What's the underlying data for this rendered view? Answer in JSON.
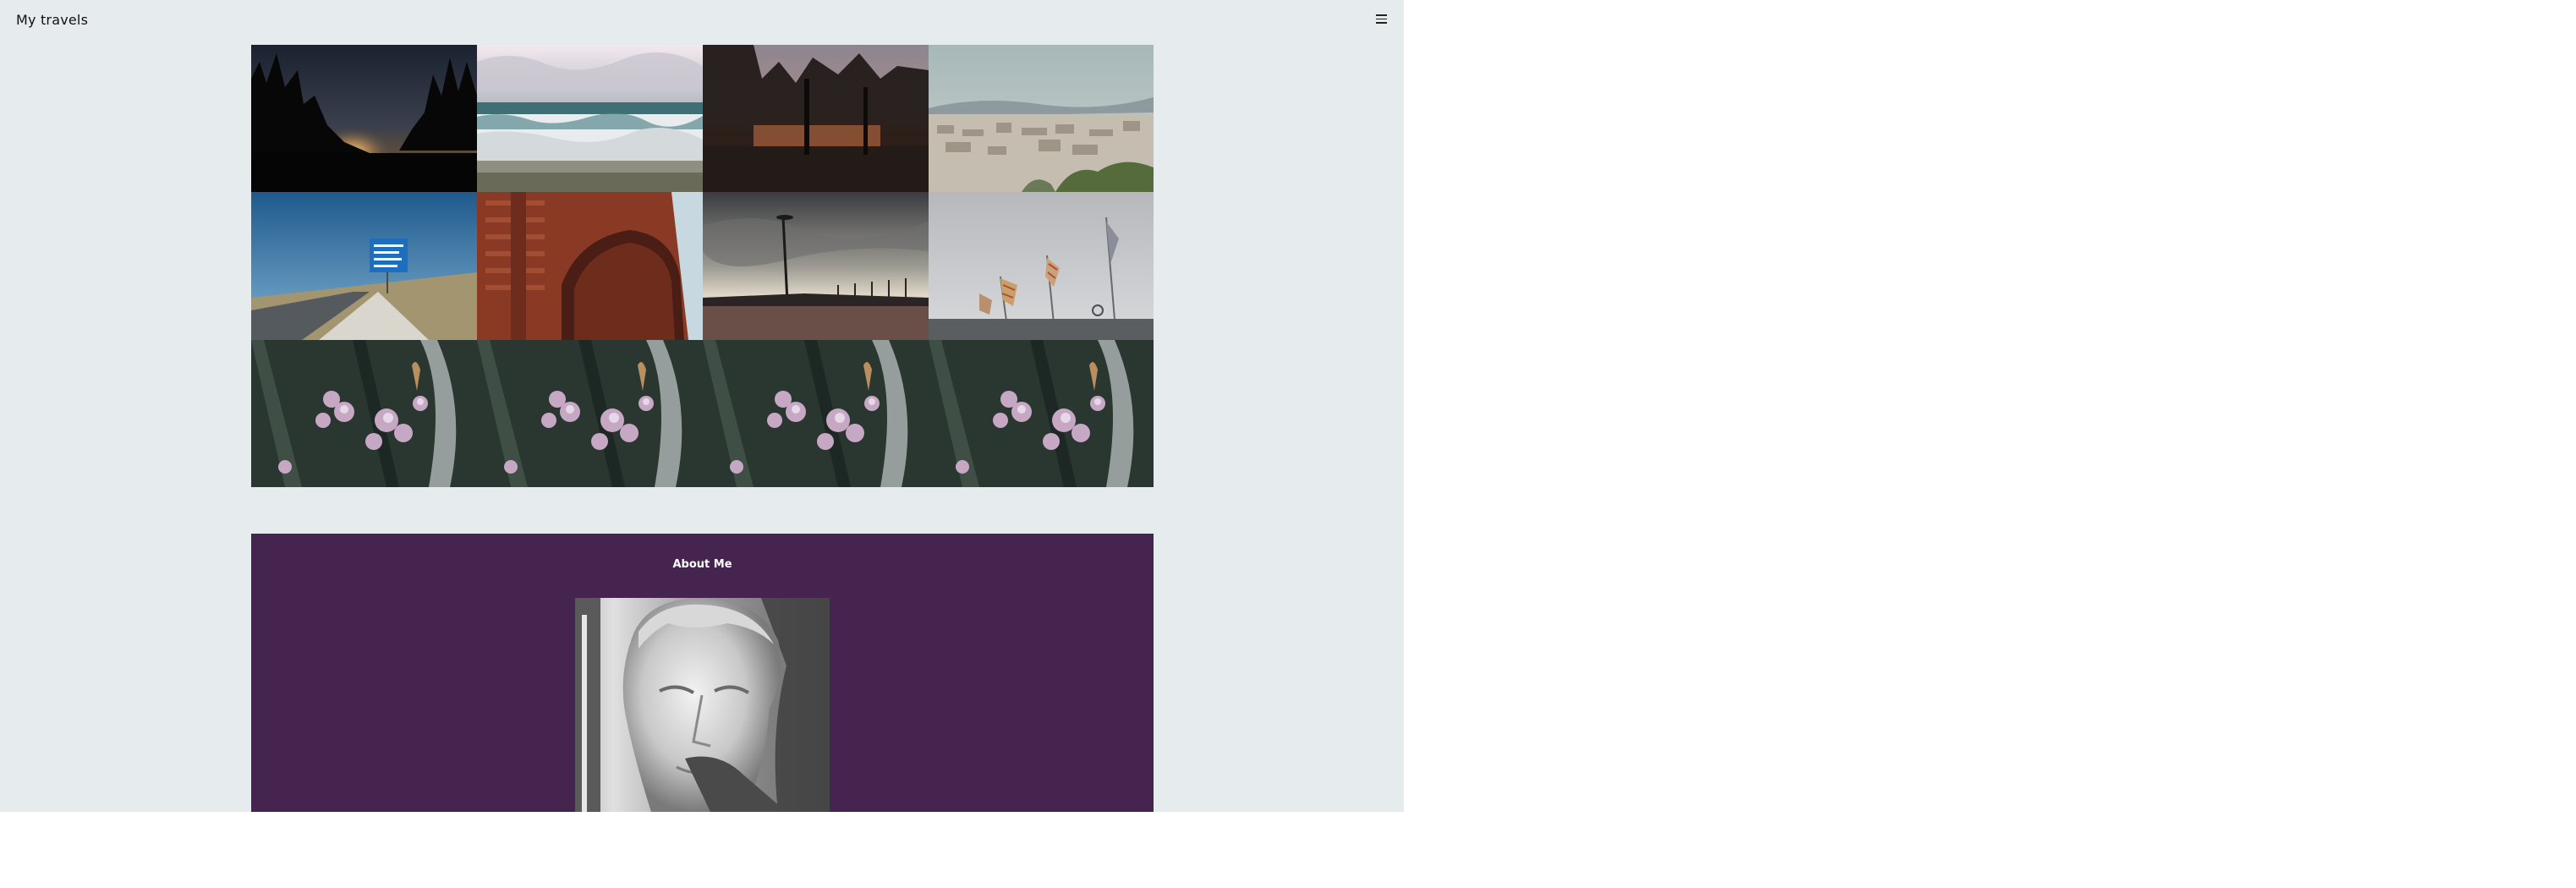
{
  "header": {
    "site_title": "My travels",
    "menu_icon": "hamburger-menu-icon"
  },
  "gallery": {
    "photos": [
      {
        "name": "photo-sunset-forest-silhouette"
      },
      {
        "name": "photo-ocean-waves-beach"
      },
      {
        "name": "photo-trees-at-dusk"
      },
      {
        "name": "photo-city-panorama"
      },
      {
        "name": "photo-highway-road-sign"
      },
      {
        "name": "photo-brick-triumphal-arch"
      },
      {
        "name": "photo-telecom-tower-plaza"
      },
      {
        "name": "photo-flags-on-poles"
      },
      {
        "name": "photo-pink-flowers-1"
      },
      {
        "name": "photo-pink-flowers-2"
      },
      {
        "name": "photo-pink-flowers-3"
      },
      {
        "name": "photo-pink-flowers-4"
      }
    ]
  },
  "about": {
    "heading": "About Me",
    "background_color": "#45254f"
  },
  "colors": {
    "page_background": "#e6ebee",
    "about_background": "#45254f",
    "title_text": "#111111"
  }
}
